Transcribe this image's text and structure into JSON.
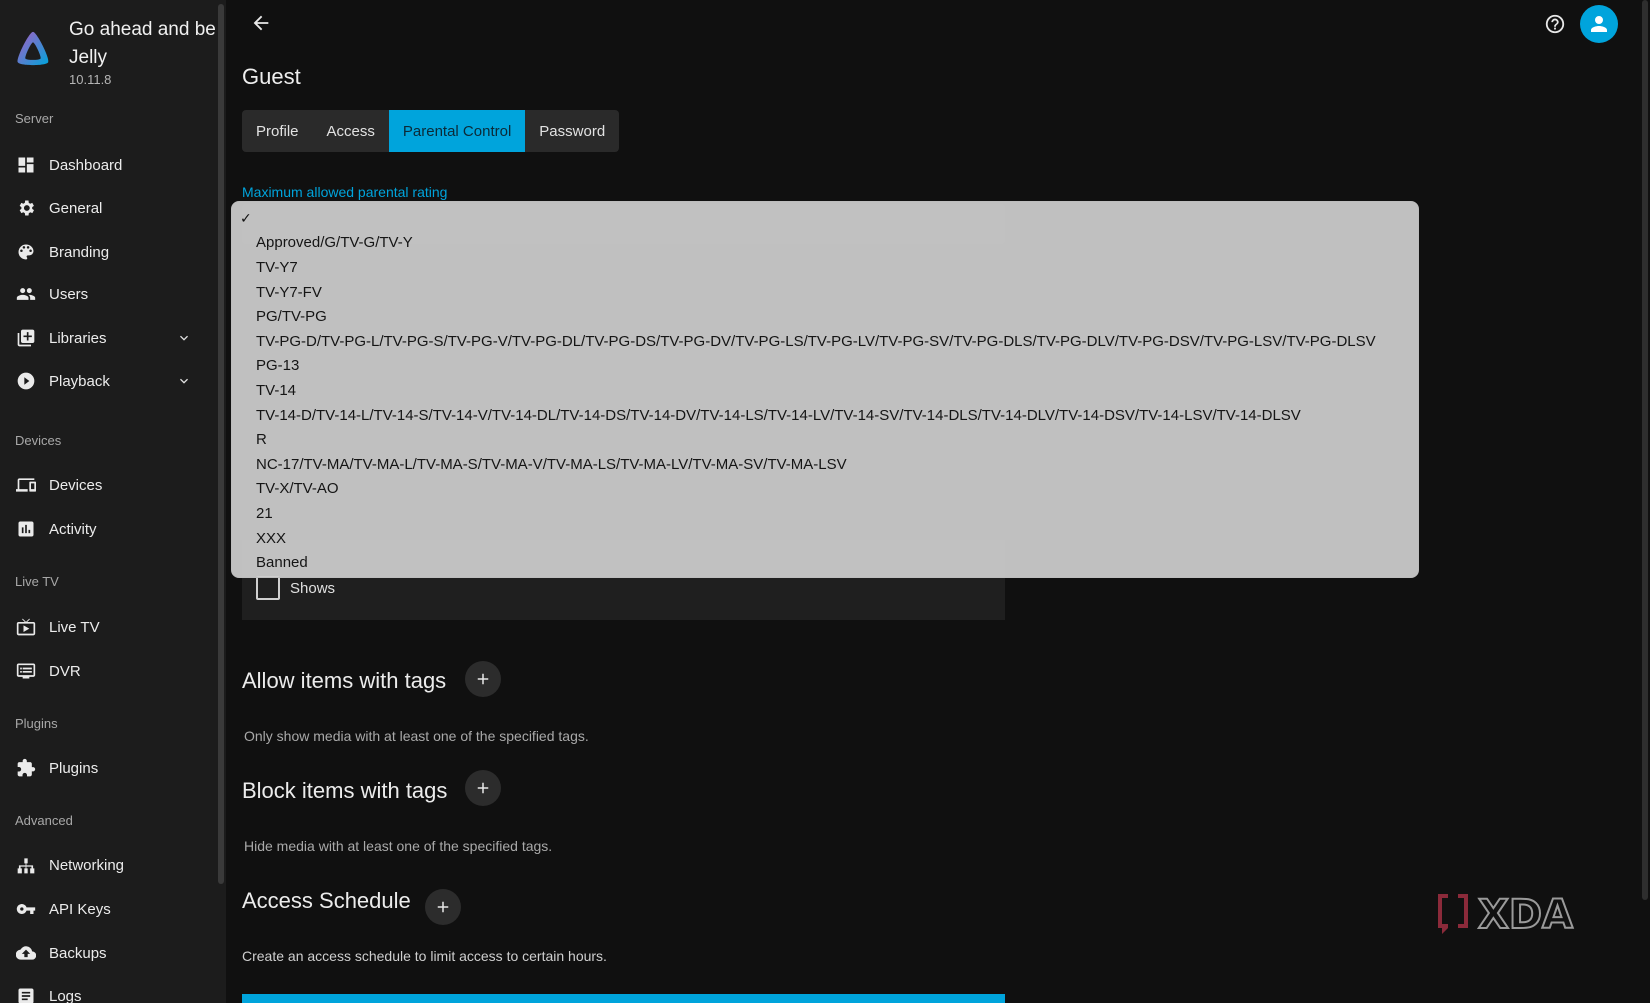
{
  "brand": {
    "name": "Go ahead and be Jelly",
    "version": "10.11.8"
  },
  "sidebar": {
    "sections": [
      {
        "label": "Server",
        "items": [
          {
            "label": "Dashboard",
            "icon": "dashboard-icon"
          },
          {
            "label": "General",
            "icon": "gear-icon"
          },
          {
            "label": "Branding",
            "icon": "palette-icon"
          },
          {
            "label": "Users",
            "icon": "users-icon"
          },
          {
            "label": "Libraries",
            "icon": "library-add-icon",
            "expandable": true
          },
          {
            "label": "Playback",
            "icon": "play-circle-icon",
            "expandable": true
          }
        ]
      },
      {
        "label": "Devices",
        "items": [
          {
            "label": "Devices",
            "icon": "devices-icon"
          },
          {
            "label": "Activity",
            "icon": "activity-chart-icon"
          }
        ]
      },
      {
        "label": "Live TV",
        "items": [
          {
            "label": "Live TV",
            "icon": "live-tv-icon"
          },
          {
            "label": "DVR",
            "icon": "dvr-icon"
          }
        ]
      },
      {
        "label": "Plugins",
        "items": [
          {
            "label": "Plugins",
            "icon": "puzzle-icon"
          }
        ]
      },
      {
        "label": "Advanced",
        "items": [
          {
            "label": "Networking",
            "icon": "network-icon"
          },
          {
            "label": "API Keys",
            "icon": "key-icon"
          },
          {
            "label": "Backups",
            "icon": "cloud-upload-icon"
          },
          {
            "label": "Logs",
            "icon": "logs-icon"
          }
        ]
      }
    ]
  },
  "page": {
    "title": "Guest",
    "tabs": [
      "Profile",
      "Access",
      "Parental Control",
      "Password"
    ],
    "active_tab": "Parental Control",
    "max_rating_label": "Maximum allowed parental rating",
    "shows_label": "Shows",
    "allow_tags": {
      "title": "Allow items with tags",
      "description": "Only show media with at least one of the specified tags."
    },
    "block_tags": {
      "title": "Block items with tags",
      "description": "Hide media with at least one of the specified tags."
    },
    "schedule": {
      "title": "Access Schedule",
      "description": "Create an access schedule to limit access to certain hours."
    }
  },
  "dropdown": {
    "selected_index": 0,
    "check_mark": "✓",
    "options": [
      "",
      "Approved/G/TV-G/TV-Y",
      "TV-Y7",
      "TV-Y7-FV",
      "PG/TV-PG",
      "TV-PG-D/TV-PG-L/TV-PG-S/TV-PG-V/TV-PG-DL/TV-PG-DS/TV-PG-DV/TV-PG-LS/TV-PG-LV/TV-PG-SV/TV-PG-DLS/TV-PG-DLV/TV-PG-DSV/TV-PG-LSV/TV-PG-DLSV",
      "PG-13",
      "TV-14",
      "TV-14-D/TV-14-L/TV-14-S/TV-14-V/TV-14-DL/TV-14-DS/TV-14-DV/TV-14-LS/TV-14-LV/TV-14-SV/TV-14-DLS/TV-14-DLV/TV-14-DSV/TV-14-LSV/TV-14-DLSV",
      "R",
      "NC-17/TV-MA/TV-MA-L/TV-MA-S/TV-MA-V/TV-MA-LS/TV-MA-LV/TV-MA-SV/TV-MA-LSV",
      "TV-X/TV-AO",
      "21",
      "XXX",
      "Banned"
    ]
  },
  "watermark": {
    "text": "XDA"
  },
  "colors": {
    "accent": "#00a4dc",
    "sidebar_bg": "#1c1c1c",
    "page_bg": "#101010"
  }
}
